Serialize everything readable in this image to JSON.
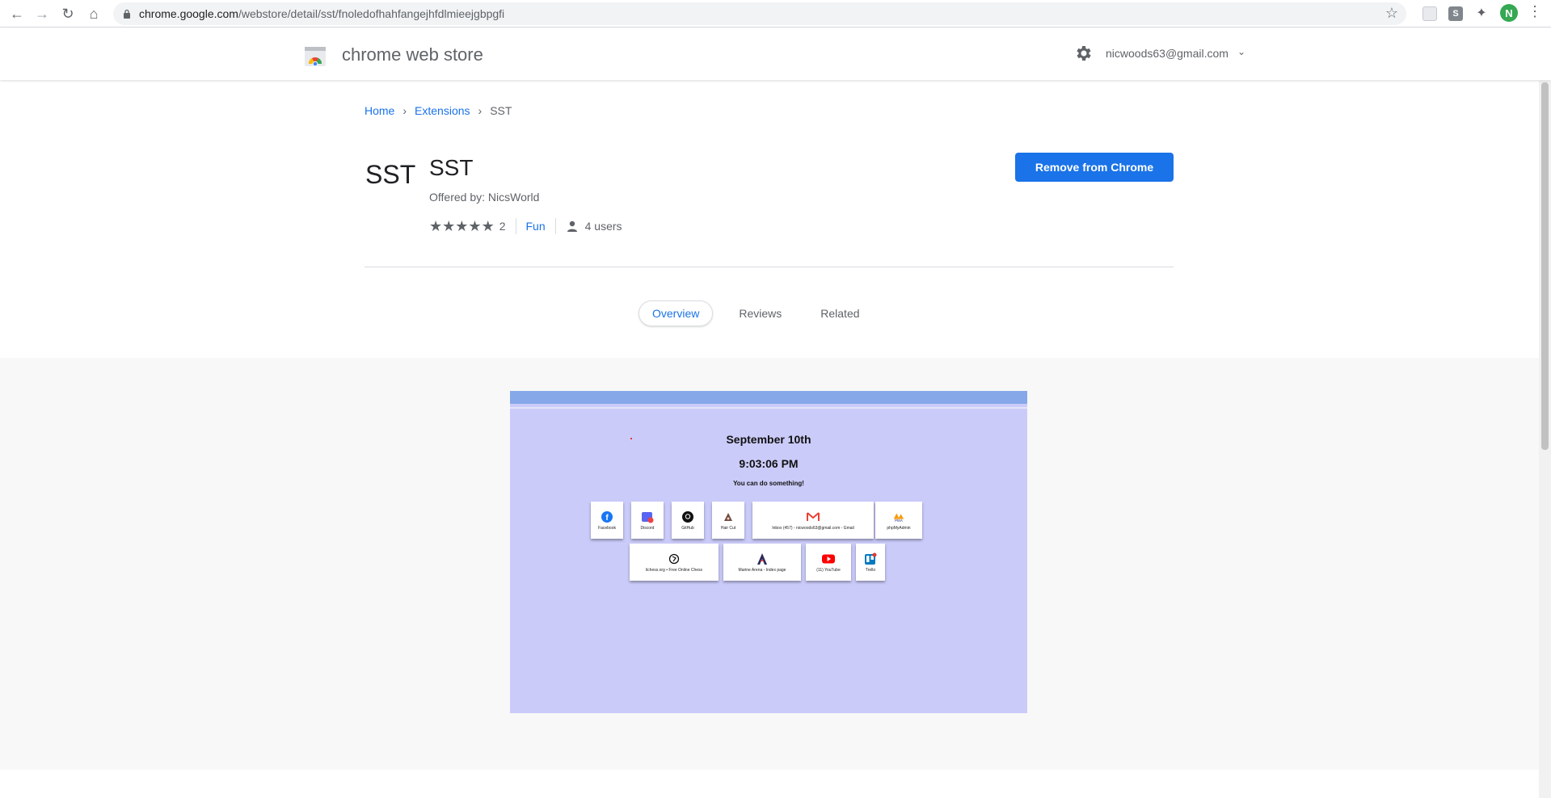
{
  "browser": {
    "url_host": "chrome.google.com",
    "url_path": "/webstore/detail/sst/fnoledofhahfangejhfdlmieejgbpgfi",
    "avatar_letter": "N",
    "extension_badge": "S"
  },
  "store": {
    "title": "chrome web store",
    "account": "nicwoods63@gmail.com"
  },
  "breadcrumb": {
    "home": "Home",
    "extensions": "Extensions",
    "current": "SST"
  },
  "item": {
    "logo_text": "SST",
    "title": "SST",
    "offered_by": "Offered by: NicsWorld",
    "rating_stars": 5,
    "rating_count": "2",
    "category": "Fun",
    "users": "4 users",
    "action_button": "Remove from Chrome"
  },
  "tabs": [
    {
      "label": "Overview",
      "active": true
    },
    {
      "label": "Reviews",
      "active": false
    },
    {
      "label": "Related",
      "active": false
    }
  ],
  "screenshot": {
    "date": "September 10th",
    "time": "9:03:06 PM",
    "message": "You can do something!",
    "tiles_row1": [
      {
        "label": "Facebook",
        "icon": "facebook-icon"
      },
      {
        "label": "Discord",
        "icon": "discord-icon"
      },
      {
        "label": "GitHub",
        "icon": "github-icon"
      },
      {
        "label": "Hair Cut",
        "icon": "haircut-icon"
      },
      {
        "label": "Inbox (457) - nicwoods63@gmail.com - Gmail",
        "icon": "gmail-icon"
      },
      {
        "label": "phpMyAdmin",
        "icon": "phpmyadmin-icon"
      }
    ],
    "tiles_row2": [
      {
        "label": "lichess.org • Free Online Chess",
        "icon": "lichess-icon"
      },
      {
        "label": "Marine Arena - Index page",
        "icon": "marine-arena-icon"
      },
      {
        "label": "(11) YouTube",
        "icon": "youtube-icon"
      },
      {
        "label": "Trello",
        "icon": "trello-icon"
      }
    ]
  },
  "colors": {
    "accent": "#1a73e8",
    "screenshot_bg": "#cbcbfa",
    "screenshot_bar": "#86a8e8"
  }
}
